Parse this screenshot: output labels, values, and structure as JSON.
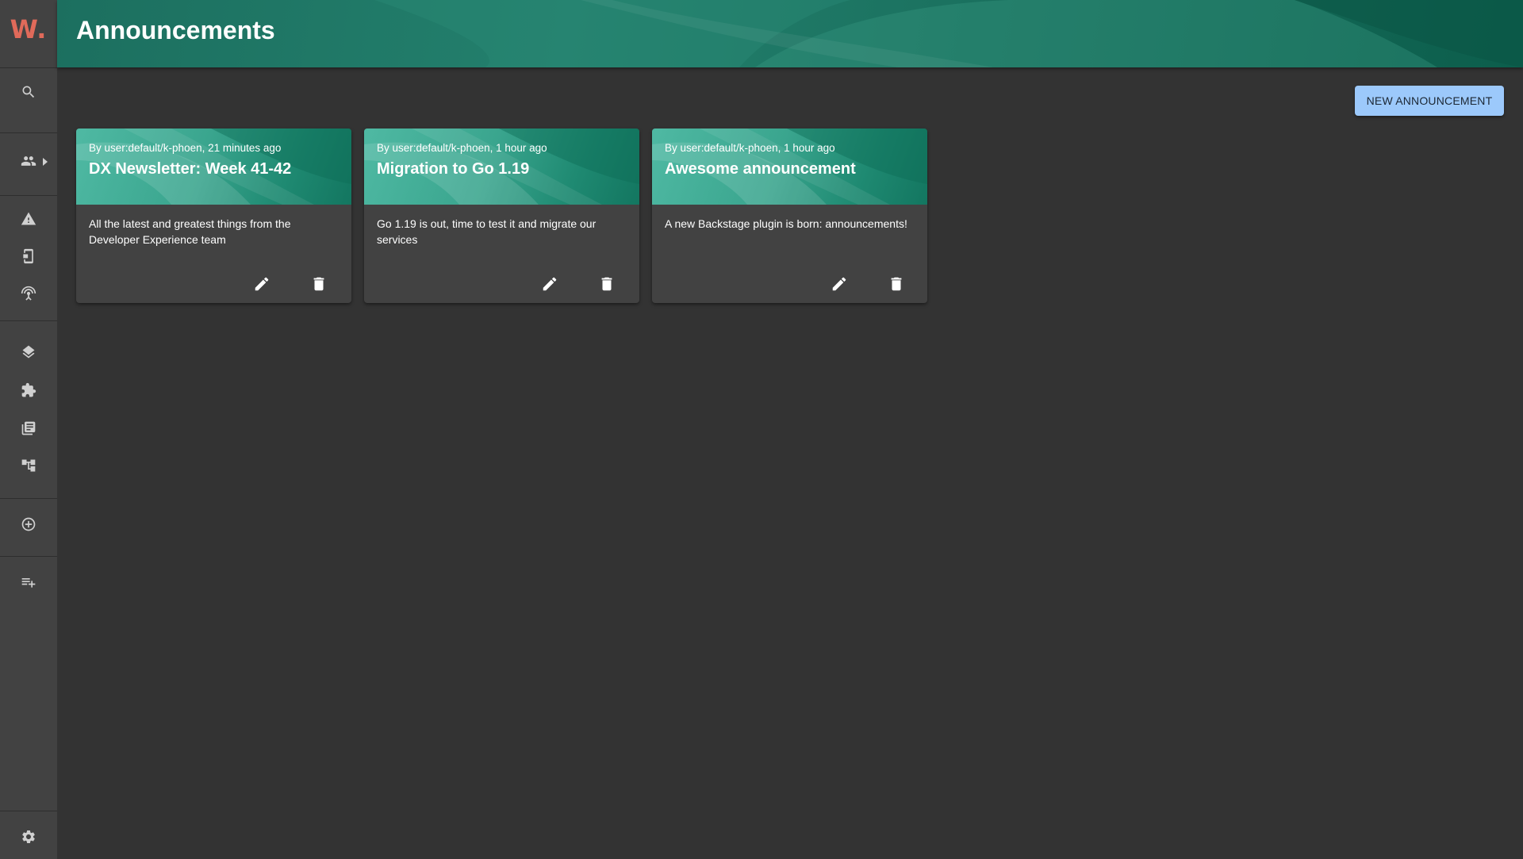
{
  "sidebar": {
    "logo": "W.",
    "items": [
      {
        "icon": "search-icon",
        "label": "Search"
      },
      {
        "icon": "people-icon",
        "label": "Groups"
      },
      {
        "icon": "warning-icon",
        "label": "Alerts"
      },
      {
        "icon": "device-icon",
        "label": "Devices"
      },
      {
        "icon": "broadcast-icon",
        "label": "Broadcast"
      },
      {
        "icon": "layers-icon",
        "label": "Layers"
      },
      {
        "icon": "puzzle-icon",
        "label": "Plugins"
      },
      {
        "icon": "library-icon",
        "label": "Docs"
      },
      {
        "icon": "tree-icon",
        "label": "Tree"
      },
      {
        "icon": "add-circle-icon",
        "label": "Create"
      },
      {
        "icon": "playlist-add-icon",
        "label": "Playlist"
      },
      {
        "icon": "gear-icon",
        "label": "Settings"
      }
    ]
  },
  "header": {
    "title": "Announcements"
  },
  "toolbar": {
    "new_label": "NEW ANNOUNCEMENT"
  },
  "announcements": [
    {
      "meta": "By user:default/k-phoen, 21 minutes ago",
      "title": "DX Newsletter: Week 41-42",
      "body": "All the latest and greatest things from the Developer Experience team"
    },
    {
      "meta": "By user:default/k-phoen, 1 hour ago",
      "title": "Migration to Go 1.19",
      "body": "Go 1.19 is out, time to test it and migrate our services"
    },
    {
      "meta": "By user:default/k-phoen, 1 hour ago",
      "title": "Awesome announcement",
      "body": "A new Backstage plugin is born: announcements!"
    }
  ],
  "colors": {
    "accent_logo": "#e06a5a",
    "header_green": "#1c6f5f",
    "button_blue": "#9cc9fb",
    "background": "#333333",
    "sidebar": "#424242"
  }
}
